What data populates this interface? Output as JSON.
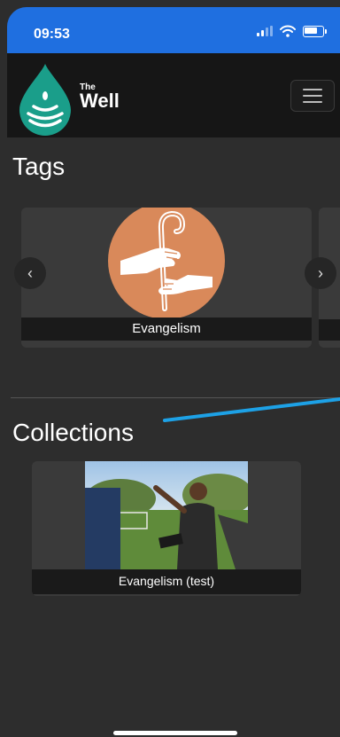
{
  "status_bar": {
    "time": "09:53"
  },
  "header": {
    "brand_top": "The",
    "brand_bottom": "Well",
    "menu_icon": "hamburger-icon"
  },
  "tags": {
    "title": "Tags",
    "items": [
      {
        "label": "Evangelism",
        "image_icon": "shepherd-staff-hands-icon"
      }
    ],
    "prev_icon": "chevron-left-icon",
    "next_icon": "chevron-right-icon"
  },
  "collections": {
    "title": "Collections",
    "items": [
      {
        "label": "Evangelism (test)"
      }
    ]
  },
  "colors": {
    "status_bar": "#1f6fe0",
    "navbar": "#161616",
    "background": "#2d2d2d",
    "logo_teal": "#1a9e8a",
    "tag_circle": "#d9895a",
    "annotation": "#1da1e6"
  }
}
